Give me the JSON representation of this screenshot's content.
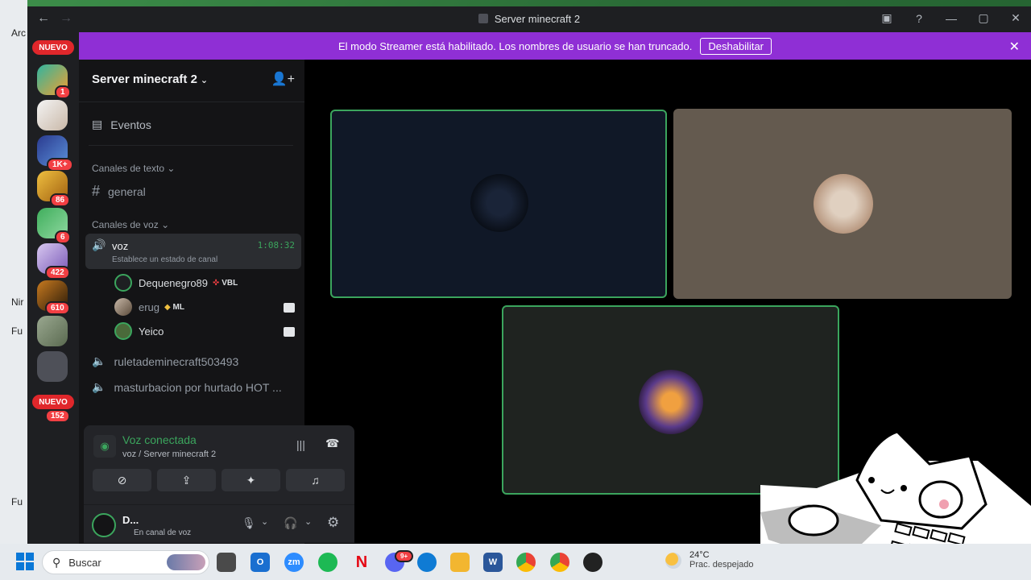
{
  "window": {
    "title": "Server minecraft 2"
  },
  "banner": {
    "text": "El modo Streamer está habilitado. Los nombres de usuario se han truncado.",
    "button": "Deshabilitar"
  },
  "rail": {
    "badges": [
      "1",
      "1K+",
      "86",
      "6",
      "422",
      "610",
      "152"
    ],
    "nuevo": "NUEVO"
  },
  "sidebar": {
    "server_name": "Server minecraft 2",
    "events": "Eventos",
    "text_category": "Canales de texto",
    "text_channel": "general",
    "voice_category": "Canales de voz",
    "voice_channel": {
      "name": "voz",
      "timer": "1:08:32",
      "status": "Establece un estado de canal"
    },
    "voice_users": [
      {
        "name": "Dequenegro89",
        "tag": "VBL"
      },
      {
        "name": "erug",
        "tag": "ML"
      },
      {
        "name": "Yeico",
        "tag": ""
      }
    ],
    "other_channels": [
      "ruletademinecraft503493",
      "masturbacion por hurtado HOT ..."
    ]
  },
  "voice_panel": {
    "status": "Voz conectada",
    "sub": "voz / Server minecraft 2",
    "user_name": "D...",
    "user_status": "En canal de voz"
  },
  "desktop": {
    "left_texts": [
      "Arc",
      "Nir",
      "Fu",
      "Fu"
    ]
  },
  "taskbar": {
    "search_placeholder": "Buscar",
    "temperature": "24°C",
    "weather": "Prac. despejado",
    "discord_badge": "9+"
  },
  "colors": {
    "banner": "#8f2fd5",
    "speaking_border": "#3ba55d",
    "connected_green": "#3ba55d"
  }
}
